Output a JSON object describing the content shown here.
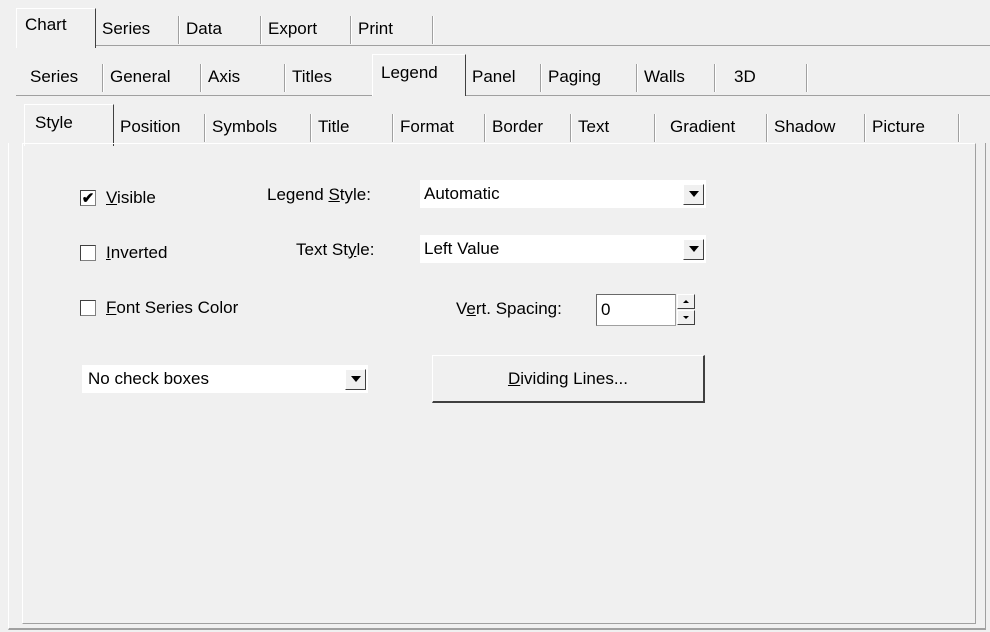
{
  "tabs_row1": [
    "Chart",
    "Series",
    "Data",
    "Export",
    "Print"
  ],
  "tabs_row2": [
    "Series",
    "General",
    "Axis",
    "Titles",
    "Legend",
    "Panel",
    "Paging",
    "Walls",
    "3D"
  ],
  "tabs_row3": [
    "Style",
    "Position",
    "Symbols",
    "Title",
    "Format",
    "Border",
    "Text",
    "Gradient",
    "Shadow",
    "Picture"
  ],
  "checks": {
    "visible": {
      "label": "Visible",
      "checked": true
    },
    "inverted": {
      "label": "Inverted",
      "checked": false
    },
    "font_series_color": {
      "label": "Font Series Color",
      "checked": false
    }
  },
  "legend_style": {
    "label": "Legend Style:",
    "value": "Automatic"
  },
  "text_style": {
    "label": "Text Style:",
    "value": "Left Value"
  },
  "vert_spacing": {
    "label": "Vert. Spacing:",
    "value": "0"
  },
  "checkbox_mode": {
    "value": "No check boxes"
  },
  "dividing_lines_button": "Dividing Lines...",
  "check_mark": "✔"
}
